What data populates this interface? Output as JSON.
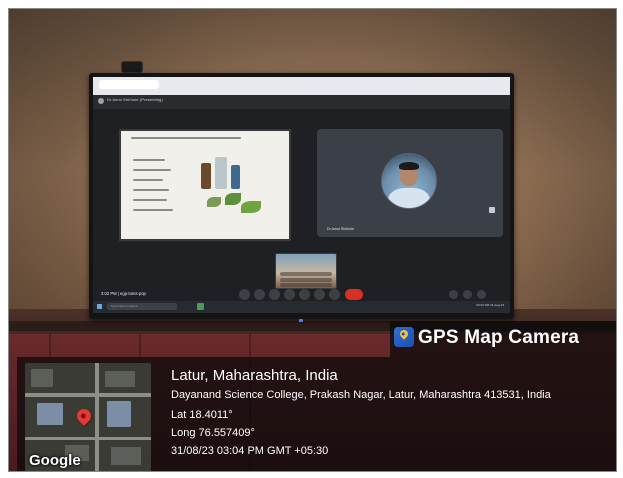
{
  "meeting": {
    "presenter_banner": "Dr.Amol Shirhule (Presenting)",
    "speaker_name": "Dr.Amol Shirhule",
    "meeting_time": "3:02 PM",
    "meeting_code": "egp-toms-pop",
    "search_placeholder": "Type here to search",
    "tray_time": "03:03 PM",
    "tray_date": "31-Aug-23"
  },
  "stamp": {
    "app_name": "GPS Map Camera",
    "map_brand": "Google",
    "location_title": "Latur, Maharashtra, India",
    "address": "Dayanand Science College, Prakash Nagar, Latur, Maharashtra 413531, India",
    "latitude": "Lat 18.4011°",
    "longitude": "Long 76.557409°",
    "datetime": "31/08/23 03:04 PM GMT +05:30"
  },
  "colors": {
    "end_call": "#d93025",
    "map_pin": "#e53935",
    "logo_blue": "#2f6fd6"
  },
  "icons": [
    "webcam-icon",
    "mic-icon",
    "camera-icon",
    "present-icon",
    "emoji-icon",
    "raise-hand-icon",
    "more-icon",
    "end-call-icon",
    "windows-start-icon",
    "location-pin-icon",
    "gps-app-logo-icon"
  ]
}
